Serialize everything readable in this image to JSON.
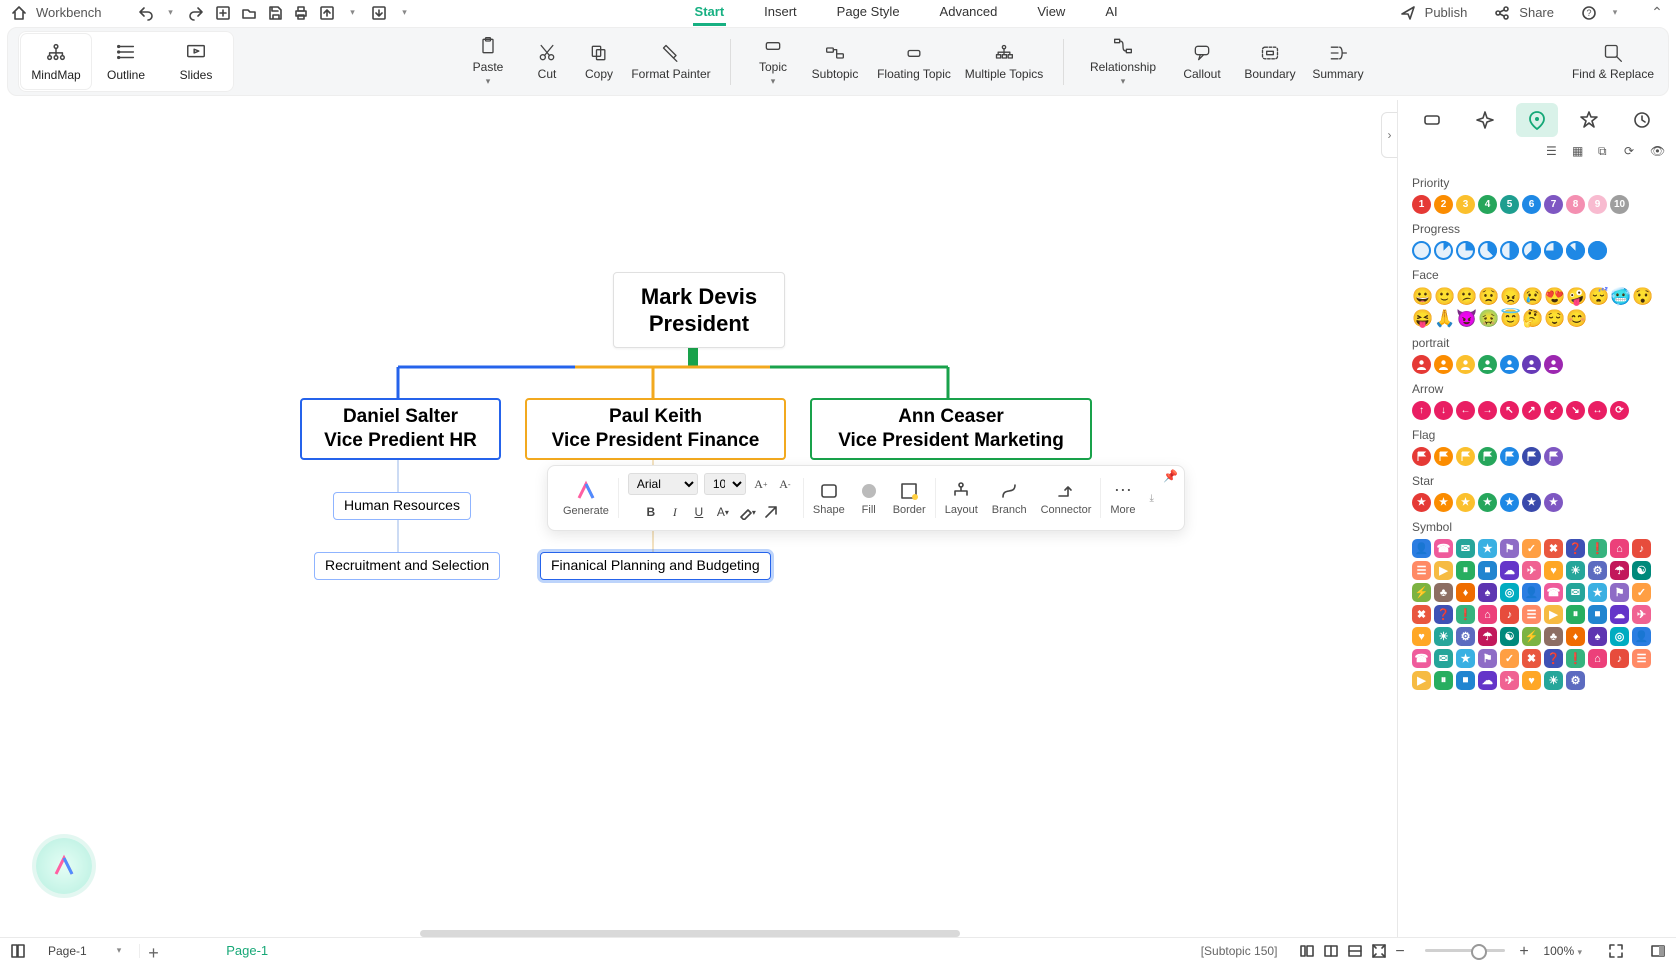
{
  "app": {
    "workbench": "Workbench"
  },
  "menu": {
    "tabs": [
      "Start",
      "Insert",
      "Page Style",
      "Advanced",
      "View",
      "AI"
    ],
    "active": 0,
    "publish": "Publish",
    "share": "Share"
  },
  "ribbon": {
    "views": {
      "mindmap": "MindMap",
      "outline": "Outline",
      "slides": "Slides"
    },
    "paste": "Paste",
    "cut": "Cut",
    "copy": "Copy",
    "format_painter": "Format Painter",
    "topic": "Topic",
    "subtopic": "Subtopic",
    "floating": "Floating Topic",
    "multiple": "Multiple Topics",
    "relationship": "Relationship",
    "callout": "Callout",
    "boundary": "Boundary",
    "summary": "Summary",
    "find_replace": "Find & Replace"
  },
  "nodes": {
    "root_l1": "Mark Devis",
    "root_l2": "President",
    "hr_l1": "Daniel Salter",
    "hr_l2": "Vice Predient HR",
    "fin_l1": "Paul Keith",
    "fin_l2": "Vice President Finance",
    "mkt_l1": "Ann Ceaser",
    "mkt_l2": "Vice President Marketing",
    "hr_sub1": "Human Resources",
    "hr_sub2": "Recruitment and Selection",
    "fin_sub1": "Finanical Planning and Budgeting"
  },
  "float": {
    "generate": "Generate",
    "font": "Arial",
    "size": "10",
    "shape": "Shape",
    "fill": "Fill",
    "border": "Border",
    "layout": "Layout",
    "branch": "Branch",
    "connector": "Connector",
    "more": "More"
  },
  "side": {
    "sections": {
      "priority": "Priority",
      "progress": "Progress",
      "face": "Face",
      "portrait": "portrait",
      "arrow": "Arrow",
      "flag": "Flag",
      "star": "Star",
      "symbol": "Symbol"
    },
    "priority_colors": [
      "#e53935",
      "#fb8c00",
      "#fbc02d",
      "#26a65b",
      "#1e9e8f",
      "#1e88e5",
      "#7e57c2",
      "#f48fb1",
      "#f8bbd0",
      "#9e9e9e"
    ],
    "portrait_colors": [
      "#e53935",
      "#fb8c00",
      "#fbc02d",
      "#26a65b",
      "#1e88e5",
      "#673ab7",
      "#9c27b0"
    ],
    "arrow_icons": [
      "↑",
      "↓",
      "←",
      "→",
      "↖",
      "↗",
      "↙",
      "↘",
      "↔",
      "⟳"
    ],
    "flag_colors": [
      "#e53935",
      "#fb8c00",
      "#fbc02d",
      "#26a65b",
      "#1e88e5",
      "#3949ab",
      "#7e57c2"
    ],
    "star_colors": [
      "#e53935",
      "#fb8c00",
      "#fbc02d",
      "#26a65b",
      "#1e88e5",
      "#3949ab",
      "#7e57c2"
    ],
    "face_row1": [
      "😀",
      "🙂",
      "😕",
      "😟",
      "😠",
      "😢",
      "😍",
      "🤪",
      "😴",
      "🥶",
      "😯"
    ],
    "face_row2": [
      "😝",
      "🙏",
      "😈",
      "🤢",
      "😇",
      "🤔",
      "😌",
      "😊"
    ],
    "progress_colors": [
      "#1e88e5",
      "#1e88e5",
      "#1e88e5",
      "#1e88e5",
      "#1e88e5",
      "#1e88e5",
      "#1e88e5",
      "#1e88e5",
      "#1e88e5"
    ],
    "symbol_colors": [
      "#2b7de1",
      "#ef5b9c",
      "#25a59a",
      "#3ab0e2",
      "#8e6cc6",
      "#ff9f43",
      "#e9573f",
      "#3f51b5",
      "#36b37e",
      "#ec407a",
      "#e74c3c",
      "#ff8a65",
      "#f6bb42",
      "#27ae60",
      "#2185d0",
      "#6435c9",
      "#f06292",
      "#ffa726",
      "#26a69a",
      "#5c6bc0",
      "#c2185b",
      "#00897b",
      "#7cb342",
      "#8d6e63",
      "#ef6c00",
      "#5e35b1",
      "#00acc1"
    ]
  },
  "status": {
    "page_sel": "Page-1",
    "page_tab": "Page-1",
    "subtopic": "[Subtopic 150]",
    "zoom": "100%"
  }
}
